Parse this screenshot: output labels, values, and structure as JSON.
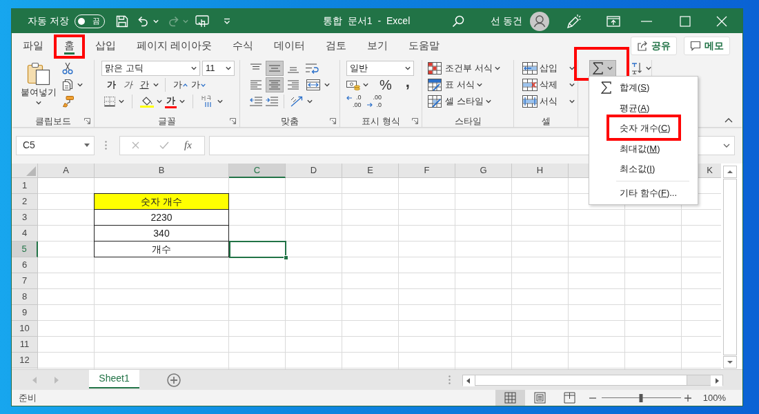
{
  "title_bar": {
    "autosave": {
      "label": "자동 저장",
      "on": false,
      "state_text": "끔"
    },
    "quick_access": [
      {
        "kind": "save",
        "disabled": false
      },
      {
        "kind": "undo",
        "disabled": false
      },
      {
        "kind": "redo",
        "disabled": true
      },
      {
        "kind": "touch",
        "disabled": false
      },
      {
        "kind": "customize",
        "disabled": false
      }
    ],
    "title": "통합 문서1 - Excel",
    "user_name": "선 동건"
  },
  "ribbon_tabs": [
    {
      "label": "파일",
      "selected": false,
      "highlighted": false
    },
    {
      "label": "홈",
      "selected": true,
      "highlighted": true
    },
    {
      "label": "삽입",
      "selected": false,
      "highlighted": false
    },
    {
      "label": "페이지 레이아웃",
      "selected": false,
      "highlighted": false
    },
    {
      "label": "수식",
      "selected": false,
      "highlighted": false
    },
    {
      "label": "데이터",
      "selected": false,
      "highlighted": false
    },
    {
      "label": "검토",
      "selected": false,
      "highlighted": false
    },
    {
      "label": "보기",
      "selected": false,
      "highlighted": false
    },
    {
      "label": "도움말",
      "selected": false,
      "highlighted": false
    }
  ],
  "ribbon_actions": [
    {
      "kind": "share",
      "label": "공유"
    },
    {
      "kind": "comments",
      "label": "메모"
    }
  ],
  "ribbon_groups": [
    {
      "kind": "clipboard",
      "label": "클립보드",
      "launcher": true,
      "paste_label": "붙여넣기"
    },
    {
      "kind": "font",
      "label": "글꼴",
      "launcher": true,
      "font_name": "맑은 고딕",
      "font_size": "11",
      "style_buttons": [
        {
          "kind": "bold",
          "text": "가"
        },
        {
          "kind": "italic",
          "text": "가"
        },
        {
          "kind": "underline",
          "text": "간"
        }
      ],
      "size_buttons": [
        {
          "kind": "grow",
          "text": "가"
        },
        {
          "kind": "shrink",
          "text": "가"
        }
      ],
      "font_color_text": "가"
    },
    {
      "kind": "alignment",
      "label": "맞춤",
      "launcher": true,
      "vertical": [
        {
          "kind": "top",
          "selected": false
        },
        {
          "kind": "middle",
          "selected": true
        },
        {
          "kind": "bottom",
          "selected": false
        }
      ],
      "horizontal": [
        {
          "kind": "left",
          "selected": false
        },
        {
          "kind": "center",
          "selected": true
        },
        {
          "kind": "right",
          "selected": false
        }
      ]
    },
    {
      "kind": "number",
      "label": "표시 형식",
      "launcher": true,
      "format": "일반",
      "symbols": [
        {
          "kind": "percent",
          "text": "%"
        },
        {
          "kind": "comma",
          "text": ","
        }
      ],
      "decimals": [
        {
          "kind": "increase",
          "top": ".0",
          "bottom": ".00"
        },
        {
          "kind": "decrease",
          "top": ".00",
          "bottom": ".0"
        }
      ]
    },
    {
      "kind": "styles",
      "label": "스타일",
      "launcher": false,
      "commands": [
        {
          "kind": "conditional",
          "label": "조건부 서식"
        },
        {
          "kind": "table",
          "label": "표 서식"
        },
        {
          "kind": "cell_style",
          "label": "셀 스타일"
        }
      ]
    },
    {
      "kind": "cells",
      "label": "셀",
      "launcher": false,
      "commands": [
        {
          "kind": "insert",
          "label": "삽입"
        },
        {
          "kind": "delete",
          "label": "삭제"
        },
        {
          "kind": "format",
          "label": "서식"
        }
      ]
    },
    {
      "kind": "editing",
      "autosum": {
        "pressed": true,
        "highlighted": true
      }
    }
  ],
  "autosum_menu": {
    "items": [
      {
        "kind": "sum",
        "label": "합계(",
        "access_key": "S",
        "suffix": ")",
        "highlighted": false,
        "separator_before": false
      },
      {
        "kind": "function",
        "label": "평균(",
        "access_key": "A",
        "suffix": ")",
        "highlighted": false,
        "separator_before": false
      },
      {
        "kind": "function",
        "label": "숫자 개수(",
        "access_key": "C",
        "suffix": ")",
        "highlighted": true,
        "separator_before": false
      },
      {
        "kind": "function",
        "label": "최대값(",
        "access_key": "M",
        "suffix": ")",
        "highlighted": false,
        "separator_before": false
      },
      {
        "kind": "function",
        "label": "최소값(",
        "access_key": "I",
        "suffix": ")",
        "highlighted": false,
        "separator_before": false
      },
      {
        "kind": "function",
        "label": "기타 함수(",
        "access_key": "F",
        "suffix": ")...",
        "highlighted": false,
        "separator_before": true
      }
    ]
  },
  "formula_bar": {
    "name_box": "C5",
    "insert_function": "fx",
    "editing": false
  },
  "sheet": {
    "columns": [
      {
        "label": "A",
        "selected": false
      },
      {
        "label": "B",
        "selected": false
      },
      {
        "label": "C",
        "selected": true
      },
      {
        "label": "D",
        "selected": false
      },
      {
        "label": "E",
        "selected": false
      },
      {
        "label": "F",
        "selected": false
      },
      {
        "label": "G",
        "selected": false
      },
      {
        "label": "H",
        "selected": false
      },
      {
        "selected": false
      },
      {},
      {
        "label": "K",
        "selected": false
      }
    ],
    "rows": [
      {
        "label": "1",
        "selected": false
      },
      {
        "label": "2",
        "selected": false
      },
      {
        "label": "3",
        "selected": false
      },
      {
        "label": "4",
        "selected": false
      },
      {
        "label": "5",
        "selected": true
      },
      {
        "label": "6",
        "selected": false
      },
      {
        "label": "7",
        "selected": false
      },
      {
        "label": "8",
        "selected": false
      },
      {
        "label": "9",
        "selected": false
      },
      {
        "label": "10",
        "selected": false
      },
      {
        "label": "11",
        "selected": false
      },
      {
        "label": "12",
        "selected": false
      }
    ],
    "table": {
      "header": "숫자 개수",
      "values": [
        "2230",
        "340",
        "개수"
      ]
    }
  },
  "sheet_tabs": [
    {
      "label": "Sheet1",
      "selected": true
    }
  ],
  "status_bar": {
    "status": "준비",
    "views": [
      {
        "kind": "normal",
        "selected": true
      },
      {
        "kind": "page_layout",
        "selected": false
      },
      {
        "kind": "page_break",
        "selected": false
      }
    ],
    "zoom": {
      "level": 0.5,
      "reading": "100%"
    }
  }
}
